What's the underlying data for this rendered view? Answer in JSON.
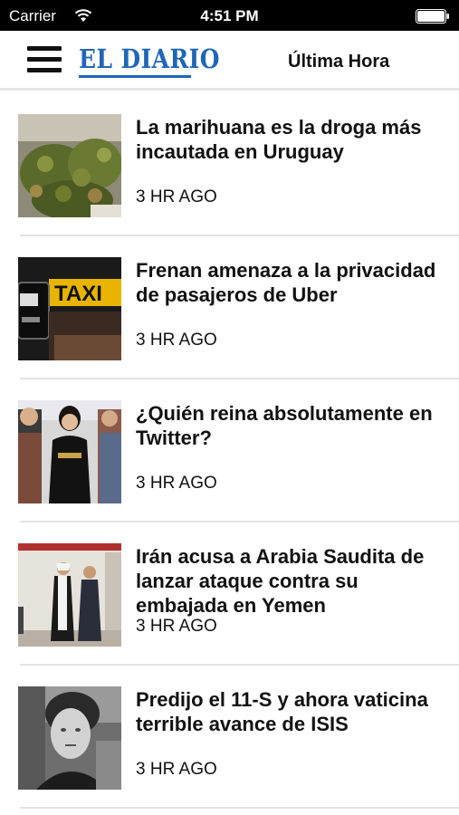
{
  "status_bar": {
    "carrier": "Carrier",
    "time": "4:51 PM",
    "wifi_icon": "wifi-icon",
    "battery_icon": "battery-icon"
  },
  "nav": {
    "menu_icon": "hamburger-menu-icon",
    "logo": "EL DIARIO",
    "section_title": "Última Hora"
  },
  "colors": {
    "brand": "#1f66b8",
    "text": "#111111",
    "divider": "#e3e3e3",
    "status_bar_bg": "#000000"
  },
  "articles": [
    {
      "headline": "La marihuana es la droga más incautada en Uruguay",
      "time_ago": "3 HR AGO",
      "thumbnail": "marijuana-photo"
    },
    {
      "headline": "Frenan amenaza a la privacidad de pasajeros de Uber",
      "time_ago": "3 HR AGO",
      "thumbnail": "taxi-sign-photo"
    },
    {
      "headline": "¿Quién reina absolutamente en Twitter?",
      "time_ago": "3 HR AGO",
      "thumbnail": "celebrities-red-carpet-photo"
    },
    {
      "headline": "Irán acusa a Arabia Saudita de lanzar ataque contra su embajada en Yemen",
      "time_ago": "3 HR AGO",
      "thumbnail": "officials-walking-photo"
    },
    {
      "headline": "Predijo el 11-S y ahora vaticina terrible avance de ISIS",
      "time_ago": "3 HR AGO",
      "thumbnail": "elderly-woman-bw-photo"
    }
  ]
}
